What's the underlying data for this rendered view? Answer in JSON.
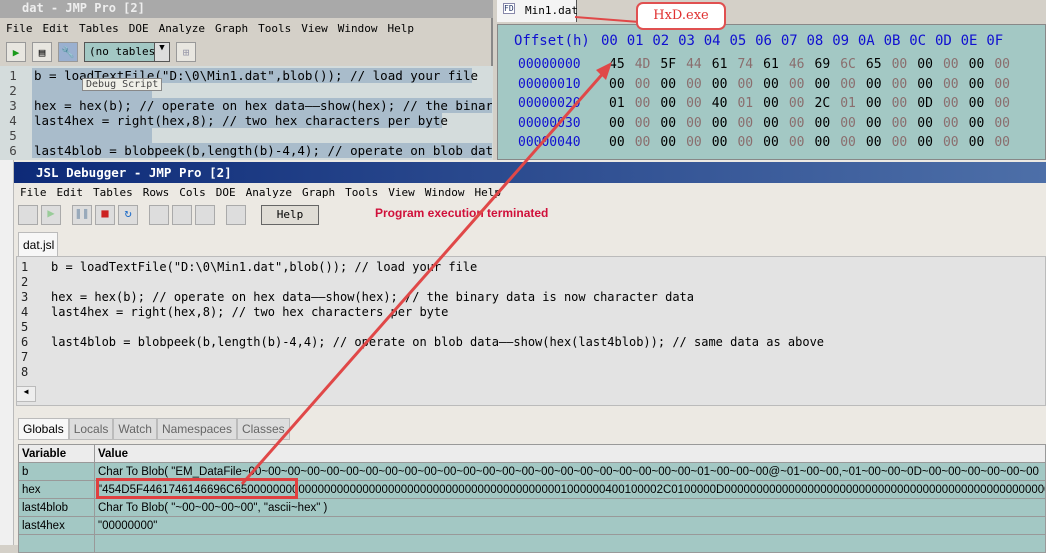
{
  "jmp": {
    "title": "dat - JMP Pro [2]",
    "menu": [
      "File",
      "Edit",
      "Tables",
      "DOE",
      "Analyze",
      "Graph",
      "Tools",
      "View",
      "Window",
      "Help"
    ],
    "tables_combo": "(no tables)",
    "tooltip": "Debug Script",
    "lines": [
      "1",
      "2",
      "3",
      "4",
      "5",
      "6"
    ]
  },
  "hxd": {
    "tab": "Min1.dat",
    "callout": "HxD.exe",
    "header": "Offset(h)",
    "cols": [
      "00",
      "01",
      "02",
      "03",
      "04",
      "05",
      "06",
      "07",
      "08",
      "09",
      "0A",
      "0B",
      "0C",
      "0D",
      "0E",
      "0F"
    ],
    "rows": [
      {
        "offset": "00000000",
        "bytes": [
          "45",
          "4D",
          "5F",
          "44",
          "61",
          "74",
          "61",
          "46",
          "69",
          "6C",
          "65",
          "00",
          "00",
          "00",
          "00",
          "00"
        ]
      },
      {
        "offset": "00000010",
        "bytes": [
          "00",
          "00",
          "00",
          "00",
          "00",
          "00",
          "00",
          "00",
          "00",
          "00",
          "00",
          "00",
          "00",
          "00",
          "00",
          "00"
        ]
      },
      {
        "offset": "00000020",
        "bytes": [
          "01",
          "00",
          "00",
          "00",
          "40",
          "01",
          "00",
          "00",
          "2C",
          "01",
          "00",
          "00",
          "0D",
          "00",
          "00",
          "00"
        ]
      },
      {
        "offset": "00000030",
        "bytes": [
          "00",
          "00",
          "00",
          "00",
          "00",
          "00",
          "00",
          "00",
          "00",
          "00",
          "00",
          "00",
          "00",
          "00",
          "00",
          "00"
        ]
      },
      {
        "offset": "00000040",
        "bytes": [
          "00",
          "00",
          "00",
          "00",
          "00",
          "00",
          "00",
          "00",
          "00",
          "00",
          "00",
          "00",
          "00",
          "00",
          "00",
          "00"
        ]
      }
    ]
  },
  "debugger": {
    "title": "JSL Debugger - JMP Pro [2]",
    "menu": [
      "File",
      "Edit",
      "Tables",
      "Rows",
      "Cols",
      "DOE",
      "Analyze",
      "Graph",
      "Tools",
      "View",
      "Window",
      "Help"
    ],
    "help_label": "Help",
    "status": "Program execution terminated",
    "file_tab": "dat.jsl",
    "code": [
      {
        "n": "1",
        "text": "b = loadTextFile(\"D:\\0\\Min1.dat\",blob()); // load your file"
      },
      {
        "n": "2",
        "text": ""
      },
      {
        "n": "3",
        "text": "hex = hex(b); // operate on hex data——show(hex); // the binary data is now character data"
      },
      {
        "n": "4",
        "text": "last4hex = right(hex,8); // two hex characters per byte"
      },
      {
        "n": "5",
        "text": ""
      },
      {
        "n": "6",
        "text": "last4blob = blobpeek(b,length(b)-4,4); // operate on blob data——show(hex(last4blob)); // same data as above"
      },
      {
        "n": "7",
        "text": ""
      },
      {
        "n": "8",
        "text": ""
      }
    ],
    "tabs": [
      "Globals",
      "Locals",
      "Watch",
      "Namespaces",
      "Classes"
    ],
    "columns": [
      "Variable",
      "Value"
    ],
    "vars": [
      {
        "name": "b",
        "value": "Char To Blob( \"EM_DataFile~00~00~00~00~00~00~00~00~00~00~00~00~00~00~00~00~00~00~00~00~00~00~00~01~00~00~00@~01~00~00,~01~00~00~0D~00~00~00~00~00~00"
      },
      {
        "name": "hex",
        "value": "\"454D5F4461746146696C6500000000000000000000000000000000000000000000000001000000400100002C0100000D0000000000000000000000000000000000000000000000000000000"
      },
      {
        "name": "last4blob",
        "value": "Char To Blob( \"~00~00~00~00\", \"ascii~hex\" )"
      },
      {
        "name": "last4hex",
        "value": "\"00000000\""
      }
    ]
  }
}
